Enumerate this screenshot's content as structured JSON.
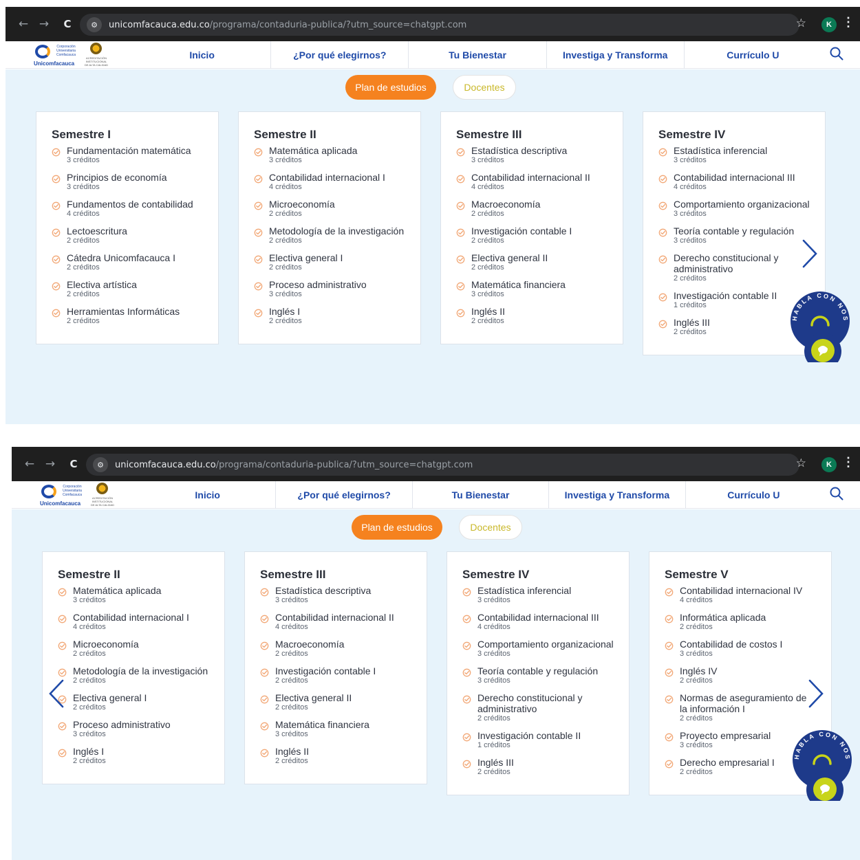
{
  "browser": {
    "url_domain": "unicomfacauca.edu.co",
    "url_path": "/programa/contaduria-publica/?utm_source=chatgpt.com",
    "nav_back": "←",
    "nav_forward": "→",
    "nav_reload": "C",
    "site_settings": "⚙",
    "star": "☆",
    "profile_initial": "K",
    "menu": "⋮"
  },
  "logo": {
    "text": "Corporación Universitaria Comfacauca",
    "brand": "Unicomfacauca",
    "seal_text": "ACREDITACIÓN INSTITUCIONAL DE ALTA CALIDAD"
  },
  "nav": {
    "items": [
      {
        "label": "Inicio"
      },
      {
        "label": "¿Por qué elegirnos?"
      },
      {
        "label": "Tu Bienestar"
      },
      {
        "label": "Investiga y Transforma"
      },
      {
        "label": "Currículo U"
      }
    ]
  },
  "tabs": {
    "plan": "Plan de estudios",
    "docentes": "Docentes"
  },
  "badge": {
    "text": "HABLA CON NOSOTROS"
  },
  "colors": {
    "accent_orange": "#f5821f",
    "brand_blue": "#1f4aa8",
    "content_bg": "#e7f3fb",
    "browser_bar": "#1f1f1f"
  },
  "screens": [
    {
      "semesters": [
        {
          "title": "Semestre I",
          "courses": [
            {
              "name": "Fundamentación matemática",
              "credits": "3 créditos"
            },
            {
              "name": "Principios de economía",
              "credits": "3 créditos"
            },
            {
              "name": "Fundamentos de contabilidad",
              "credits": "4 créditos"
            },
            {
              "name": "Lectoescritura",
              "credits": "2 créditos"
            },
            {
              "name": "Cátedra Unicomfacauca I",
              "credits": "2 créditos"
            },
            {
              "name": "Electiva artística",
              "credits": "2 créditos"
            },
            {
              "name": "Herramientas Informáticas",
              "credits": "2 créditos"
            }
          ]
        },
        {
          "title": "Semestre II",
          "courses": [
            {
              "name": "Matemática aplicada",
              "credits": "3 créditos"
            },
            {
              "name": "Contabilidad internacional I",
              "credits": "4 créditos"
            },
            {
              "name": "Microeconomía",
              "credits": "2 créditos"
            },
            {
              "name": "Metodología de la investigación",
              "credits": "2 créditos"
            },
            {
              "name": "Electiva general I",
              "credits": "2 créditos"
            },
            {
              "name": "Proceso administrativo",
              "credits": "3 créditos"
            },
            {
              "name": "Inglés I",
              "credits": "2 créditos"
            }
          ]
        },
        {
          "title": "Semestre III",
          "courses": [
            {
              "name": "Estadística descriptiva",
              "credits": "3 créditos"
            },
            {
              "name": "Contabilidad internacional II",
              "credits": "4 créditos"
            },
            {
              "name": "Macroeconomía",
              "credits": "2 créditos"
            },
            {
              "name": "Investigación contable I",
              "credits": "2 créditos"
            },
            {
              "name": "Electiva general II",
              "credits": "2 créditos"
            },
            {
              "name": "Matemática financiera",
              "credits": "3 créditos"
            },
            {
              "name": "Inglés II",
              "credits": "2 créditos"
            }
          ]
        },
        {
          "title": "Semestre IV",
          "courses": [
            {
              "name": "Estadística inferencial",
              "credits": "3 créditos"
            },
            {
              "name": "Contabilidad internacional III",
              "credits": "4 créditos"
            },
            {
              "name": "Comportamiento organizacional",
              "credits": "3 créditos"
            },
            {
              "name": "Teoría contable y regulación",
              "credits": "3 créditos"
            },
            {
              "name": "Derecho constitucional y administrativo",
              "credits": "2 créditos"
            },
            {
              "name": "Investigación contable II",
              "credits": "1 créditos"
            },
            {
              "name": "Inglés III",
              "credits": "2 créditos"
            }
          ]
        }
      ]
    },
    {
      "semesters": [
        {
          "title": "Semestre II",
          "courses": [
            {
              "name": "Matemática aplicada",
              "credits": "3 créditos"
            },
            {
              "name": "Contabilidad internacional I",
              "credits": "4 créditos"
            },
            {
              "name": "Microeconomía",
              "credits": "2 créditos"
            },
            {
              "name": "Metodología de la investigación",
              "credits": "2 créditos"
            },
            {
              "name": "Electiva general I",
              "credits": "2 créditos"
            },
            {
              "name": "Proceso administrativo",
              "credits": "3 créditos"
            },
            {
              "name": "Inglés I",
              "credits": "2 créditos"
            }
          ]
        },
        {
          "title": "Semestre III",
          "courses": [
            {
              "name": "Estadística descriptiva",
              "credits": "3 créditos"
            },
            {
              "name": "Contabilidad internacional II",
              "credits": "4 créditos"
            },
            {
              "name": "Macroeconomía",
              "credits": "2 créditos"
            },
            {
              "name": "Investigación contable I",
              "credits": "2 créditos"
            },
            {
              "name": "Electiva general II",
              "credits": "2 créditos"
            },
            {
              "name": "Matemática financiera",
              "credits": "3 créditos"
            },
            {
              "name": "Inglés II",
              "credits": "2 créditos"
            }
          ]
        },
        {
          "title": "Semestre IV",
          "courses": [
            {
              "name": "Estadística inferencial",
              "credits": "3 créditos"
            },
            {
              "name": "Contabilidad internacional III",
              "credits": "4 créditos"
            },
            {
              "name": "Comportamiento organizacional",
              "credits": "3 créditos"
            },
            {
              "name": "Teoría contable y regulación",
              "credits": "3 créditos"
            },
            {
              "name": "Derecho constitucional y administrativo",
              "credits": "2 créditos"
            },
            {
              "name": "Investigación contable II",
              "credits": "1 créditos"
            },
            {
              "name": "Inglés III",
              "credits": "2 créditos"
            }
          ]
        },
        {
          "title": "Semestre V",
          "courses": [
            {
              "name": "Contabilidad internacional IV",
              "credits": "4 créditos"
            },
            {
              "name": "Informática aplicada",
              "credits": "2 créditos"
            },
            {
              "name": "Contabilidad de costos I",
              "credits": "3 créditos"
            },
            {
              "name": "Inglés IV",
              "credits": "2 créditos"
            },
            {
              "name": "Normas de aseguramiento de la información I",
              "credits": "2 créditos"
            },
            {
              "name": "Proyecto empresarial",
              "credits": "3 créditos"
            },
            {
              "name": "Derecho empresarial I",
              "credits": "2 créditos"
            }
          ]
        }
      ]
    }
  ]
}
